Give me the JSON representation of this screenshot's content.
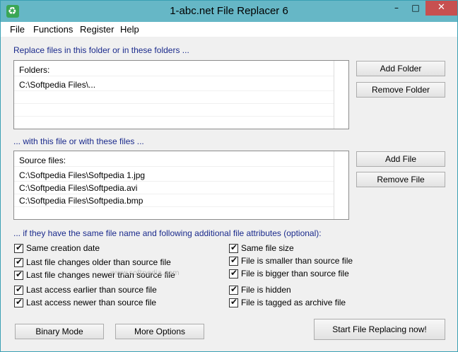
{
  "window": {
    "title": "1-abc.net File Replacer 6"
  },
  "menu": [
    "File",
    "Functions",
    "Register",
    "Help"
  ],
  "folders": {
    "label": "Replace files in this folder or in these folders ...",
    "header": "Folders:",
    "items": [
      "C:\\Softpedia Files\\..."
    ],
    "add_button": "Add Folder",
    "remove_button": "Remove Folder"
  },
  "files": {
    "label": "... with this file or with these files ...",
    "header": "Source files:",
    "items": [
      "C:\\Softpedia Files\\Softpedia 1.jpg",
      "C:\\Softpedia Files\\Softpedia.avi",
      "C:\\Softpedia Files\\Softpedia.bmp"
    ],
    "add_button": "Add File",
    "remove_button": "Remove File"
  },
  "attributes": {
    "label": "... if they have the same file name and following additional file attributes (optional):",
    "left": [
      {
        "label": "Same creation date",
        "checked": true
      },
      {
        "label": "Last file changes older than source file",
        "checked": true
      },
      {
        "label": "Last file changes newer than source file",
        "checked": true
      },
      {
        "label": "Last access earlier than source file",
        "checked": true
      },
      {
        "label": "Last access newer than source file",
        "checked": true
      }
    ],
    "right": [
      {
        "label": "Same file size",
        "checked": true
      },
      {
        "label": "File is smaller than source file",
        "checked": true
      },
      {
        "label": "File is bigger than source file",
        "checked": true
      },
      {
        "label": "File is hidden",
        "checked": true
      },
      {
        "label": "File is tagged as archive file",
        "checked": true
      }
    ]
  },
  "buttons": {
    "binary_mode": "Binary Mode",
    "more_options": "More Options",
    "start": "Start File Replacing now!"
  },
  "watermark": "www.softpedia.com",
  "colors": {
    "titlebar": "#66b7c6",
    "close": "#c75050",
    "section_text": "#1a2a8c"
  }
}
